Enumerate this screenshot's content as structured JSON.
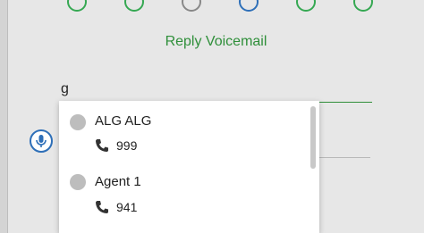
{
  "header": {
    "title": "Reply Voicemail"
  },
  "recipient_input": {
    "value": "g"
  },
  "suggestions": [
    {
      "name": "ALG ALG",
      "extension": "999"
    },
    {
      "name": "Agent 1",
      "extension": "941"
    }
  ],
  "colors": {
    "accent_green": "#2f8f3a",
    "accent_blue": "#2e6fb8",
    "status_gray": "#bdbdbd"
  },
  "icons": {
    "mic": "microphone-icon",
    "phone": "phone-icon"
  }
}
